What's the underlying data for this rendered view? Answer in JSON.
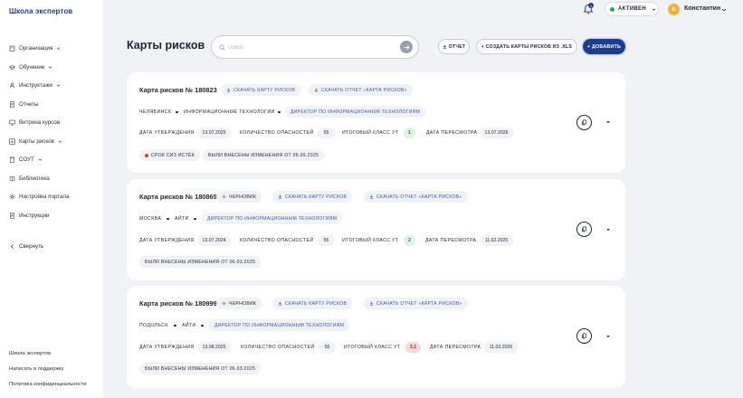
{
  "app": {
    "logo": "Школа экспертов"
  },
  "sidebar": {
    "items": [
      {
        "label": "Организация",
        "icon": "building-icon",
        "has_chevron": true
      },
      {
        "label": "Обучение",
        "icon": "graduation-icon",
        "has_chevron": true
      },
      {
        "label": "Инструктажи",
        "icon": "person-icon",
        "has_chevron": true
      },
      {
        "label": "Отчеты",
        "icon": "document-icon",
        "has_chevron": false
      },
      {
        "label": "Витрина курсов",
        "icon": "monitor-icon",
        "has_chevron": false
      },
      {
        "label": "Карты рисков",
        "icon": "chart-icon",
        "has_chevron": true
      },
      {
        "label": "СОУТ",
        "icon": "clipboard-icon",
        "has_chevron": true
      },
      {
        "label": "Библиотека",
        "icon": "book-icon",
        "has_chevron": false
      },
      {
        "label": "Настройка портала",
        "icon": "gear-icon",
        "has_chevron": false
      },
      {
        "label": "Инструкции",
        "icon": "document-icon",
        "has_chevron": false
      }
    ],
    "collapse_label": "Свернуть",
    "footer_links": [
      "Школа экспертов",
      "Написать в поддержку",
      "Политика конфиденциальности"
    ]
  },
  "header": {
    "notification_count": "1",
    "status_label": "АКТИВЕН",
    "avatar_initial": "К",
    "user_name": "Константин"
  },
  "toolbar": {
    "title": "Карты рисков",
    "search_placeholder": "Поиск",
    "report_label": "ОТЧЕТ",
    "create_xls_label": "+ СОЗДАТЬ КАРТЫ РИСКОВ ИЗ .XLS",
    "add_label": "+ ДОБАВИТЬ"
  },
  "labels": {
    "download_map": "СКАЧАТЬ КАРТУ РИСКОВ",
    "download_report": "СКАЧАТЬ ОТЧЕТ «КАРТА РИСКОВ»",
    "approval_date": "ДАТА УТВЕРЖДЕНИЯ",
    "hazards_count": "КОЛИЧЕСТВО ОПАСНОСТЕЙ",
    "final_class": "ИТОГОВЫЙ КЛАСС УТ",
    "review_date": "ДАТА ПЕРЕСМОТРА",
    "draft": "ЧЕРНОВИК"
  },
  "cards": [
    {
      "title": "Карта рисков № 180823",
      "city": "ЧЕЛЯБИНСК",
      "department": "ИНФОРМАЦИОННЫЕ ТЕХНОЛОГИИ",
      "position": "ДИРЕКТОР ПО ИНФОРМАЦИОННЫМ ТЕХНОЛОГИЯМ",
      "approval_date": "13.07.2025",
      "hazards": "55",
      "class": "1",
      "review_date": "13.07.2026",
      "warning": "СРОК СИЗ ИСТЁК",
      "changes": "БЫЛИ ВНЕСЕНЫ ИЗМЕНЕНИЯ ОТ 06.09.2025"
    },
    {
      "title": "Карта рисков № 180865",
      "city": "МОСКВА",
      "department": "АЙТИ",
      "position": "ДИРЕКТОР ПО ИНФОРМАЦИОННЫМ ТЕХНОЛОГИЯМ",
      "approval_date": "13.07.2024",
      "hazards": "55",
      "class": "2",
      "review_date": "11.02.2025",
      "changes": "БЫЛИ ВНЕСЕНЫ ИЗМЕНЕНИЯ ОТ 06.03.2025"
    },
    {
      "title": "Карта рисков № 180999",
      "city": "ПОДОЛЬСК",
      "department": "АЙТИ",
      "position": "ДИРЕКТОР ПО ИНФОРМАЦИОННЫМ ТЕХНОЛОГИЯМ",
      "approval_date": "13.08.2025",
      "hazards": "55",
      "class": "3.1",
      "review_date": "11.03.2026",
      "changes": "БЫЛИ ВНЕСЕНЫ ИЗМЕНЕНИЯ ОТ 06.03.2025"
    }
  ],
  "colors": {
    "brand": "#1d3b8f",
    "link": "#3a57b8",
    "active": "#2ea44f",
    "danger": "#e23b3b"
  }
}
